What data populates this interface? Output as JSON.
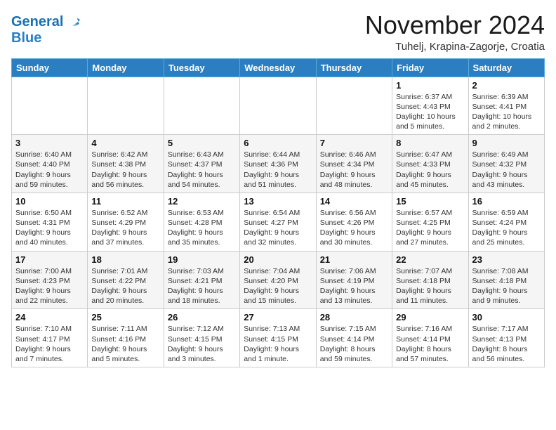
{
  "header": {
    "logo_line1": "General",
    "logo_line2": "Blue",
    "month_title": "November 2024",
    "location": "Tuhelj, Krapina-Zagorje, Croatia"
  },
  "weekdays": [
    "Sunday",
    "Monday",
    "Tuesday",
    "Wednesday",
    "Thursday",
    "Friday",
    "Saturday"
  ],
  "weeks": [
    [
      null,
      null,
      null,
      null,
      null,
      {
        "day": "1",
        "sunrise": "Sunrise: 6:37 AM",
        "sunset": "Sunset: 4:43 PM",
        "daylight": "Daylight: 10 hours and 5 minutes."
      },
      {
        "day": "2",
        "sunrise": "Sunrise: 6:39 AM",
        "sunset": "Sunset: 4:41 PM",
        "daylight": "Daylight: 10 hours and 2 minutes."
      }
    ],
    [
      {
        "day": "3",
        "sunrise": "Sunrise: 6:40 AM",
        "sunset": "Sunset: 4:40 PM",
        "daylight": "Daylight: 9 hours and 59 minutes."
      },
      {
        "day": "4",
        "sunrise": "Sunrise: 6:42 AM",
        "sunset": "Sunset: 4:38 PM",
        "daylight": "Daylight: 9 hours and 56 minutes."
      },
      {
        "day": "5",
        "sunrise": "Sunrise: 6:43 AM",
        "sunset": "Sunset: 4:37 PM",
        "daylight": "Daylight: 9 hours and 54 minutes."
      },
      {
        "day": "6",
        "sunrise": "Sunrise: 6:44 AM",
        "sunset": "Sunset: 4:36 PM",
        "daylight": "Daylight: 9 hours and 51 minutes."
      },
      {
        "day": "7",
        "sunrise": "Sunrise: 6:46 AM",
        "sunset": "Sunset: 4:34 PM",
        "daylight": "Daylight: 9 hours and 48 minutes."
      },
      {
        "day": "8",
        "sunrise": "Sunrise: 6:47 AM",
        "sunset": "Sunset: 4:33 PM",
        "daylight": "Daylight: 9 hours and 45 minutes."
      },
      {
        "day": "9",
        "sunrise": "Sunrise: 6:49 AM",
        "sunset": "Sunset: 4:32 PM",
        "daylight": "Daylight: 9 hours and 43 minutes."
      }
    ],
    [
      {
        "day": "10",
        "sunrise": "Sunrise: 6:50 AM",
        "sunset": "Sunset: 4:31 PM",
        "daylight": "Daylight: 9 hours and 40 minutes."
      },
      {
        "day": "11",
        "sunrise": "Sunrise: 6:52 AM",
        "sunset": "Sunset: 4:29 PM",
        "daylight": "Daylight: 9 hours and 37 minutes."
      },
      {
        "day": "12",
        "sunrise": "Sunrise: 6:53 AM",
        "sunset": "Sunset: 4:28 PM",
        "daylight": "Daylight: 9 hours and 35 minutes."
      },
      {
        "day": "13",
        "sunrise": "Sunrise: 6:54 AM",
        "sunset": "Sunset: 4:27 PM",
        "daylight": "Daylight: 9 hours and 32 minutes."
      },
      {
        "day": "14",
        "sunrise": "Sunrise: 6:56 AM",
        "sunset": "Sunset: 4:26 PM",
        "daylight": "Daylight: 9 hours and 30 minutes."
      },
      {
        "day": "15",
        "sunrise": "Sunrise: 6:57 AM",
        "sunset": "Sunset: 4:25 PM",
        "daylight": "Daylight: 9 hours and 27 minutes."
      },
      {
        "day": "16",
        "sunrise": "Sunrise: 6:59 AM",
        "sunset": "Sunset: 4:24 PM",
        "daylight": "Daylight: 9 hours and 25 minutes."
      }
    ],
    [
      {
        "day": "17",
        "sunrise": "Sunrise: 7:00 AM",
        "sunset": "Sunset: 4:23 PM",
        "daylight": "Daylight: 9 hours and 22 minutes."
      },
      {
        "day": "18",
        "sunrise": "Sunrise: 7:01 AM",
        "sunset": "Sunset: 4:22 PM",
        "daylight": "Daylight: 9 hours and 20 minutes."
      },
      {
        "day": "19",
        "sunrise": "Sunrise: 7:03 AM",
        "sunset": "Sunset: 4:21 PM",
        "daylight": "Daylight: 9 hours and 18 minutes."
      },
      {
        "day": "20",
        "sunrise": "Sunrise: 7:04 AM",
        "sunset": "Sunset: 4:20 PM",
        "daylight": "Daylight: 9 hours and 15 minutes."
      },
      {
        "day": "21",
        "sunrise": "Sunrise: 7:06 AM",
        "sunset": "Sunset: 4:19 PM",
        "daylight": "Daylight: 9 hours and 13 minutes."
      },
      {
        "day": "22",
        "sunrise": "Sunrise: 7:07 AM",
        "sunset": "Sunset: 4:18 PM",
        "daylight": "Daylight: 9 hours and 11 minutes."
      },
      {
        "day": "23",
        "sunrise": "Sunrise: 7:08 AM",
        "sunset": "Sunset: 4:18 PM",
        "daylight": "Daylight: 9 hours and 9 minutes."
      }
    ],
    [
      {
        "day": "24",
        "sunrise": "Sunrise: 7:10 AM",
        "sunset": "Sunset: 4:17 PM",
        "daylight": "Daylight: 9 hours and 7 minutes."
      },
      {
        "day": "25",
        "sunrise": "Sunrise: 7:11 AM",
        "sunset": "Sunset: 4:16 PM",
        "daylight": "Daylight: 9 hours and 5 minutes."
      },
      {
        "day": "26",
        "sunrise": "Sunrise: 7:12 AM",
        "sunset": "Sunset: 4:15 PM",
        "daylight": "Daylight: 9 hours and 3 minutes."
      },
      {
        "day": "27",
        "sunrise": "Sunrise: 7:13 AM",
        "sunset": "Sunset: 4:15 PM",
        "daylight": "Daylight: 9 hours and 1 minute."
      },
      {
        "day": "28",
        "sunrise": "Sunrise: 7:15 AM",
        "sunset": "Sunset: 4:14 PM",
        "daylight": "Daylight: 8 hours and 59 minutes."
      },
      {
        "day": "29",
        "sunrise": "Sunrise: 7:16 AM",
        "sunset": "Sunset: 4:14 PM",
        "daylight": "Daylight: 8 hours and 57 minutes."
      },
      {
        "day": "30",
        "sunrise": "Sunrise: 7:17 AM",
        "sunset": "Sunset: 4:13 PM",
        "daylight": "Daylight: 8 hours and 56 minutes."
      }
    ]
  ]
}
